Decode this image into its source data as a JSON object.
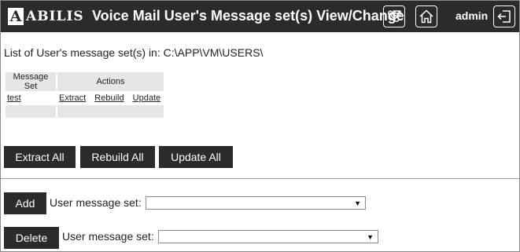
{
  "header": {
    "logo_letter": "A",
    "logo_text": "ABILIS",
    "title": "Voice Mail User's Message set(s) View/Change",
    "user": "admin",
    "icons": [
      "voicemail-icon",
      "home-icon",
      "logout-icon"
    ]
  },
  "main": {
    "path_text": "List of User's message set(s) in: C:\\APP\\VM\\USERS\\",
    "table": {
      "headers": [
        "Message Set",
        "Actions"
      ],
      "rows": [
        {
          "name": "test",
          "actions": [
            "Extract",
            "Rebuild",
            "Update"
          ]
        }
      ]
    },
    "buttons": {
      "extract_all": "Extract All",
      "rebuild_all": "Rebuild All",
      "update_all": "Update All"
    }
  },
  "add_section": {
    "button": "Add",
    "label": "User message set:",
    "selected": ""
  },
  "delete_section": {
    "button": "Delete",
    "label": "User message set:",
    "selected": ""
  },
  "colors": {
    "header_bg": "#2b2b2b",
    "button_bg": "#2b2b2b",
    "table_header_bg": "#e6e6e6"
  }
}
